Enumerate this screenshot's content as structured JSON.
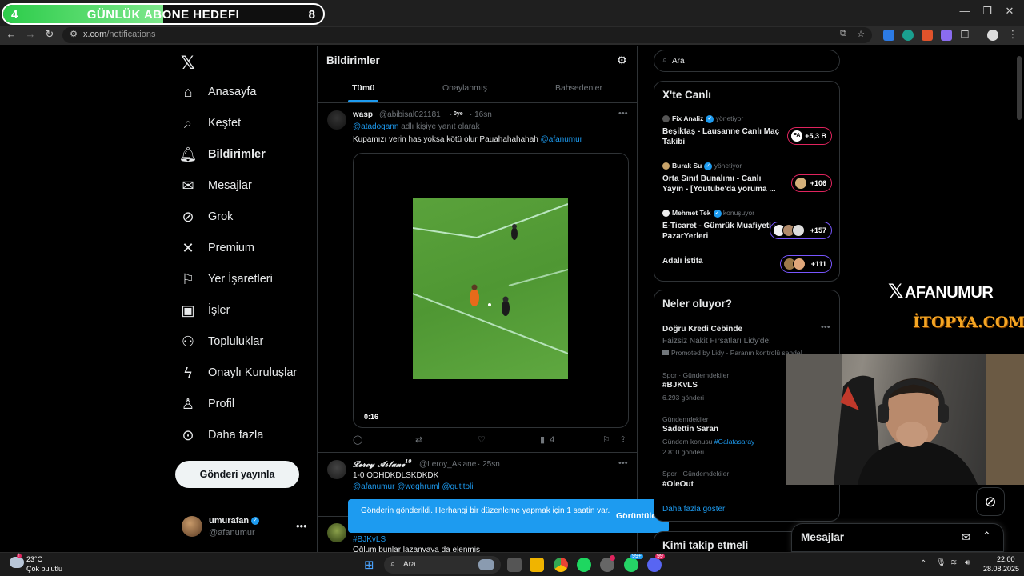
{
  "goal": {
    "left": "4",
    "title": "GÜNLÜK ABONE HEDEFI",
    "right": "8",
    "progress": 0.5
  },
  "browser": {
    "url_host": "x.com",
    "url_path": "/notifications"
  },
  "nav": {
    "items": [
      {
        "label": "Anasayfa",
        "icon": "home-icon"
      },
      {
        "label": "Keşfet",
        "icon": "search-icon"
      },
      {
        "label": "Bildirimler",
        "icon": "bell-icon"
      },
      {
        "label": "Mesajlar",
        "icon": "mail-icon"
      },
      {
        "label": "Grok",
        "icon": "grok-icon"
      },
      {
        "label": "Premium",
        "icon": "x-logo-icon"
      },
      {
        "label": "Yer İşaretleri",
        "icon": "bookmark-icon"
      },
      {
        "label": "İşler",
        "icon": "briefcase-icon"
      },
      {
        "label": "Topluluklar",
        "icon": "people-icon"
      },
      {
        "label": "Onaylı Kuruluşlar",
        "icon": "lightning-icon"
      },
      {
        "label": "Profil",
        "icon": "person-icon"
      },
      {
        "label": "Daha fazla",
        "icon": "more-circle-icon"
      }
    ],
    "post_button": "Gönderi yayınla",
    "account": {
      "name": "umurafan",
      "handle": "@afanumur"
    }
  },
  "main": {
    "title": "Bildirimler",
    "tabs": [
      "Tümü",
      "Onaylanmış",
      "Bahsedenler"
    ],
    "tweet1": {
      "name": "wasp",
      "handle": "@abibisal021181",
      "badge": "0ye",
      "time": "· 16sn",
      "reply_mention": "@atadogann",
      "reply_suffix": " adlı kişiye yanıt olarak",
      "text": "Kupamızı verin has yoksa kötü olur Pauahahahahah ",
      "text_mention": "@afanumur",
      "video_time": "0:16",
      "views": "4"
    },
    "tweet2": {
      "name": "𝓛𝓮𝓻𝓸𝔂 𝓐𝓼𝓵𝓪𝓷𝓮",
      "sup": "10",
      "handle": "@Leroy_Aslane",
      "time": "· 25sn",
      "text": "1-0 ODHDKDLSKDKDK",
      "mentions": "@afanumur @weghruml @gutitoli"
    },
    "tweet3": {
      "hashtag": "#BJKvLS",
      "text": "Oğlum bunlar lazanyaya da elenmiş"
    },
    "toast": {
      "message": "Gönderin gönderildi. Herhangi bir düzenleme yapmak için 1 saatin var.",
      "action": "Görüntüle"
    }
  },
  "right": {
    "search_placeholder": "Ara",
    "live": {
      "title": "X'te Canlı",
      "items": [
        {
          "host": "Fix Analiz",
          "role": "yönetiyor",
          "title": "Beşiktaş - Lausanne Canlı Maç Takibi",
          "count": "+5,3 B",
          "pill_color": "#e0245e"
        },
        {
          "host": "Burak Su",
          "role": "yönetiyor",
          "title": "Orta Sınıf Bunalımı -  Canlı Yayın - [Youtube'da yoruma ...",
          "count": "+106",
          "pill_color": "#e0245e"
        },
        {
          "host": "Mehmet Tek",
          "role": "konuşuyor",
          "title": "E-Ticaret - Gümrük Muafiyeti - PazarYerleri",
          "count": "+157",
          "pill_color": "#7856ff"
        },
        {
          "host": "",
          "role": "",
          "title": "Adalı İstifa",
          "count": "+111",
          "pill_color": "#7856ff"
        }
      ]
    },
    "trends": {
      "title": "Neler oluyor?",
      "promo": {
        "name": "Doğru Kredi Cebinde",
        "desc": "Faizsiz Nakit Fırsatları Lidy'de!",
        "promoted": "Promoted by Lidy - Paranın kontrolü sende!"
      },
      "items": [
        {
          "category": "Spor · Gündemdekiler",
          "name": "#BJKvLS",
          "sub": "6.293 gönderi"
        },
        {
          "category": "Gündemdekiler",
          "name": "Sadettin Saran",
          "sub_prefix": "Gündem konusu ",
          "sub_link": "#Galatasaray",
          "sub2": "2.810 gönderi"
        },
        {
          "category": "Spor · Gündemdekiler",
          "name": "#OleOut",
          "sub": ""
        }
      ],
      "show_more": "Daha fazla göster"
    },
    "follow_title": "Kimi takip etmeli"
  },
  "overlay": {
    "brand": "AFANUMUR",
    "site": "İTOPYA.COM"
  },
  "messages_drawer": {
    "title": "Mesajlar"
  },
  "taskbar": {
    "weather_temp": "23°C",
    "weather_desc": "Çok bulutlu",
    "search": "Ara",
    "time": "22:00",
    "date": "28.08.2025",
    "badges": [
      "99+",
      "99"
    ]
  },
  "colors": {
    "accent": "#1d9bf0",
    "background": "#000000",
    "border": "#2f3336",
    "goal_green": "#2ccc4a"
  }
}
